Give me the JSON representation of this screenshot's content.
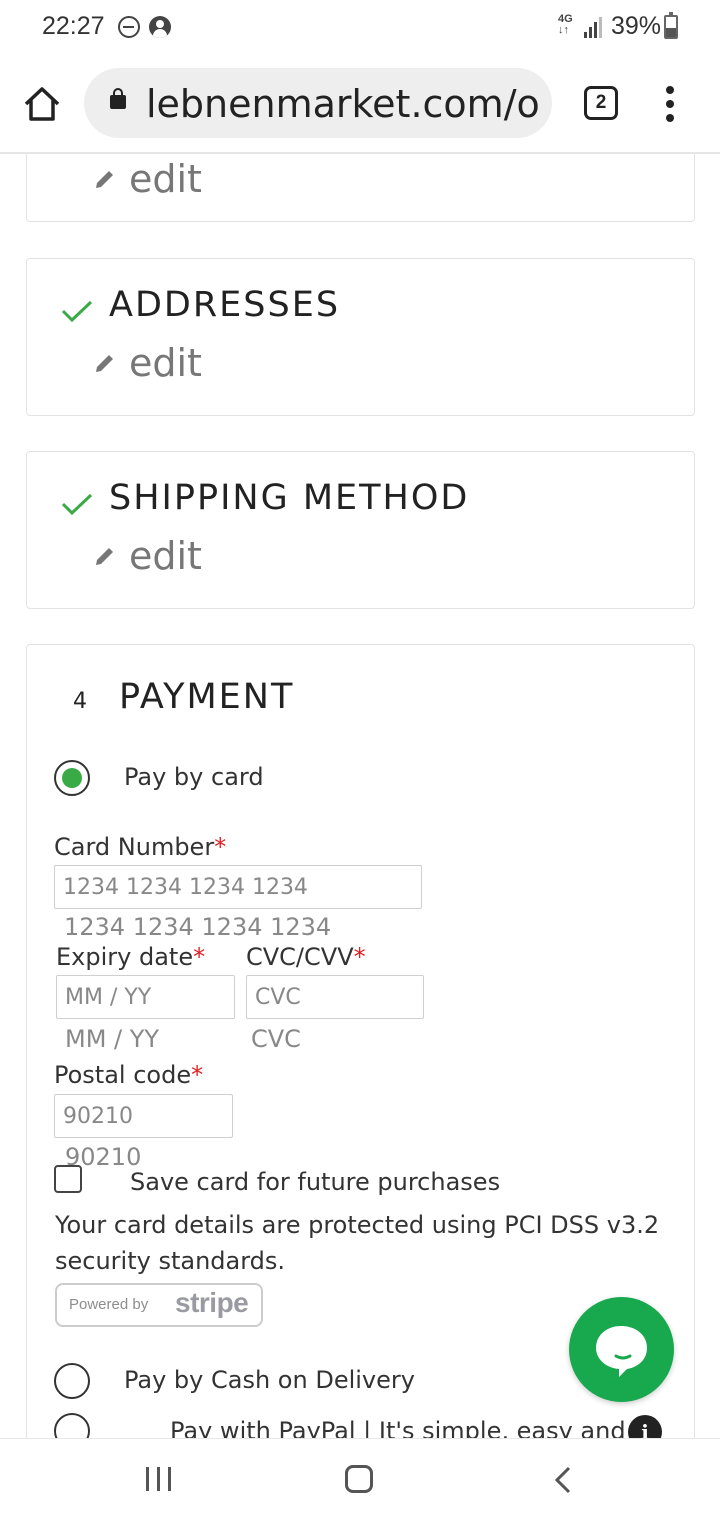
{
  "status_bar": {
    "time": "22:27",
    "network": "4G",
    "battery": "39%"
  },
  "browser": {
    "url": "lebnenmarket.com/o",
    "tab_count": "2"
  },
  "checkout": {
    "steps": [
      {
        "title": "",
        "edit": "edit"
      },
      {
        "title": "ADDRESSES",
        "edit": "edit"
      },
      {
        "title": "SHIPPING METHOD",
        "edit": "edit"
      }
    ],
    "payment": {
      "step_number": "4",
      "title": "PAYMENT",
      "pay_by_card": "Pay by card",
      "card_number_label": "Card Number",
      "card_number_placeholder": "1234 1234 1234 1234",
      "card_number_ghost": "1234 1234 1234 1234",
      "expiry_label": "Expiry date",
      "expiry_placeholder": "MM / YY",
      "expiry_ghost": "MM / YY",
      "cvc_label": "CVC/CVV",
      "cvc_placeholder": "CVC",
      "cvc_ghost": "CVC",
      "postal_label": "Postal code",
      "postal_placeholder": "90210",
      "postal_ghost": "90210",
      "required_mark": "*",
      "save_card": "Save card for future purchases",
      "security_note": "Your card details are protected using PCI DSS v3.2 security standards.",
      "powered_by": "Powered by",
      "stripe": "stripe",
      "cash_on_delivery": "Pay by Cash on Delivery",
      "paypal": "Pay with PayPal | It's simple, easy and",
      "info_glyph": "i"
    }
  },
  "colors": {
    "accent_green": "#3aaa47",
    "chat_green": "#18a84e",
    "required_red": "#e02020"
  }
}
